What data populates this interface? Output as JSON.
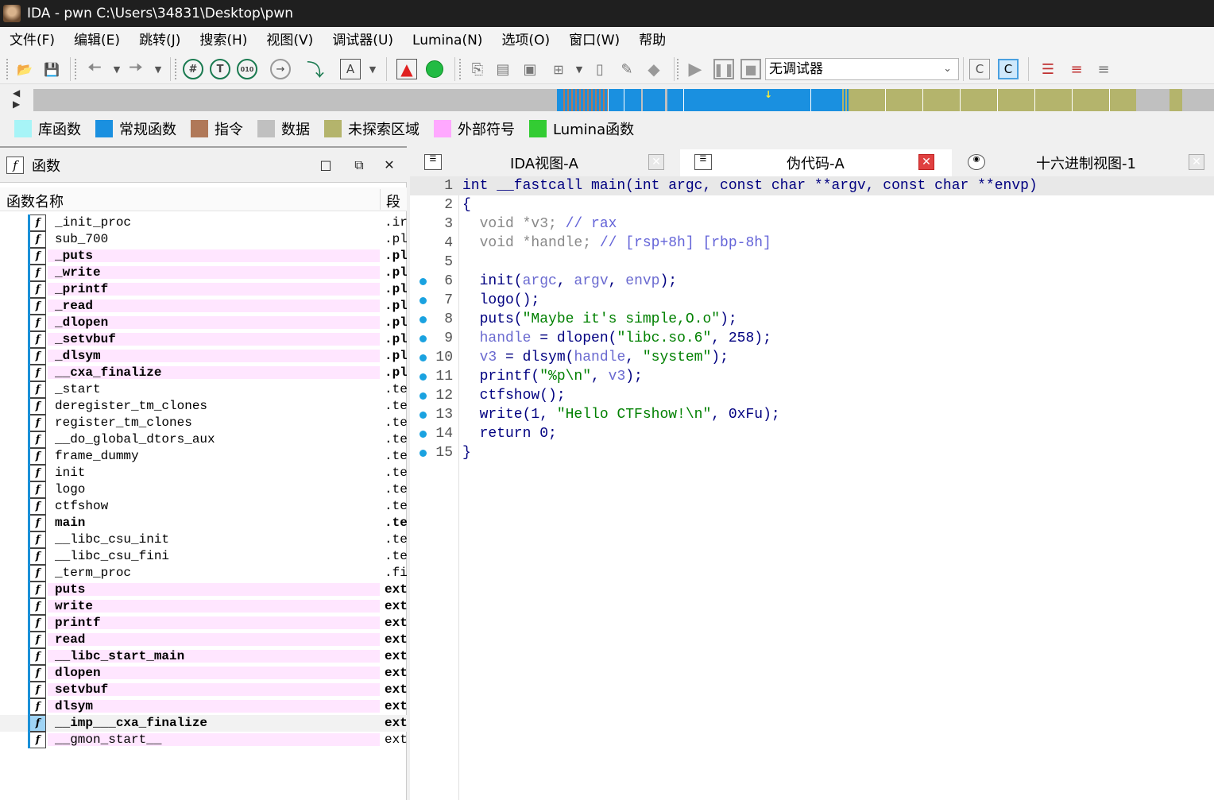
{
  "window": {
    "title": "IDA - pwn C:\\Users\\34831\\Desktop\\pwn"
  },
  "menu": [
    "文件(F)",
    "编辑(E)",
    "跳转(J)",
    "搜索(H)",
    "视图(V)",
    "调试器(U)",
    "Lumina(N)",
    "选项(O)",
    "窗口(W)",
    "帮助"
  ],
  "toolbar": {
    "debugger_select": "无调试器",
    "icons": [
      "open-icon",
      "save-icon",
      "back-icon",
      "forward-icon",
      "hex-icon",
      "text-icon",
      "binary-icon",
      "plugin-icon",
      "jump-icon",
      "string-icon",
      "run-icon",
      "green-circle-icon",
      "play-icon",
      "pause-icon",
      "stop-icon"
    ]
  },
  "legend": [
    {
      "label": "库函数",
      "color": "#a7f4f7"
    },
    {
      "label": "常规函数",
      "color": "#1a90e0"
    },
    {
      "label": "指令",
      "color": "#b07858"
    },
    {
      "label": "数据",
      "color": "#c0c0c0"
    },
    {
      "label": "未探索区域",
      "color": "#b4b46c"
    },
    {
      "label": "外部符号",
      "color": "#ffa8ff"
    },
    {
      "label": "Lumina函数",
      "color": "#33cc33"
    }
  ],
  "functions_panel": {
    "title": "函数",
    "col_name": "函数名称",
    "col_segment": "段",
    "rows": [
      {
        "name": "_init_proc",
        "seg": ".ir",
        "bold": false,
        "pink": false
      },
      {
        "name": "sub_700",
        "seg": ".pl",
        "bold": false,
        "pink": false
      },
      {
        "name": "_puts",
        "seg": ".pl",
        "bold": true,
        "pink": true
      },
      {
        "name": "_write",
        "seg": ".pl",
        "bold": true,
        "pink": true
      },
      {
        "name": "_printf",
        "seg": ".pl",
        "bold": true,
        "pink": true
      },
      {
        "name": "_read",
        "seg": ".pl",
        "bold": true,
        "pink": true
      },
      {
        "name": "_dlopen",
        "seg": ".pl",
        "bold": true,
        "pink": true
      },
      {
        "name": "_setvbuf",
        "seg": ".pl",
        "bold": true,
        "pink": true
      },
      {
        "name": "_dlsym",
        "seg": ".pl",
        "bold": true,
        "pink": true
      },
      {
        "name": "__cxa_finalize",
        "seg": ".pl",
        "bold": true,
        "pink": true
      },
      {
        "name": "_start",
        "seg": ".te",
        "bold": false,
        "pink": false
      },
      {
        "name": "deregister_tm_clones",
        "seg": ".te",
        "bold": false,
        "pink": false
      },
      {
        "name": "register_tm_clones",
        "seg": ".te",
        "bold": false,
        "pink": false
      },
      {
        "name": "__do_global_dtors_aux",
        "seg": ".te",
        "bold": false,
        "pink": false
      },
      {
        "name": "frame_dummy",
        "seg": ".te",
        "bold": false,
        "pink": false
      },
      {
        "name": "init",
        "seg": ".te",
        "bold": false,
        "pink": false
      },
      {
        "name": "logo",
        "seg": ".te",
        "bold": false,
        "pink": false
      },
      {
        "name": "ctfshow",
        "seg": ".te",
        "bold": false,
        "pink": false
      },
      {
        "name": "main",
        "seg": ".te",
        "bold": true,
        "pink": false
      },
      {
        "name": "__libc_csu_init",
        "seg": ".te",
        "bold": false,
        "pink": false
      },
      {
        "name": "__libc_csu_fini",
        "seg": ".te",
        "bold": false,
        "pink": false
      },
      {
        "name": "_term_proc",
        "seg": ".fi",
        "bold": false,
        "pink": false
      },
      {
        "name": "puts",
        "seg": "ext",
        "bold": true,
        "pink": true
      },
      {
        "name": "write",
        "seg": "ext",
        "bold": true,
        "pink": true
      },
      {
        "name": "printf",
        "seg": "ext",
        "bold": true,
        "pink": true
      },
      {
        "name": "read",
        "seg": "ext",
        "bold": true,
        "pink": true
      },
      {
        "name": "__libc_start_main",
        "seg": "ext",
        "bold": true,
        "pink": true
      },
      {
        "name": "dlopen",
        "seg": "ext",
        "bold": true,
        "pink": true
      },
      {
        "name": "setvbuf",
        "seg": "ext",
        "bold": true,
        "pink": true
      },
      {
        "name": "dlsym",
        "seg": "ext",
        "bold": true,
        "pink": true
      },
      {
        "name": "__imp___cxa_finalize",
        "seg": "ext",
        "bold": true,
        "pink": false,
        "selected": true
      },
      {
        "name": "__gmon_start__",
        "seg": "ext",
        "bold": false,
        "pink": true
      }
    ]
  },
  "tabs": [
    {
      "label": "IDA视图-A",
      "active": false
    },
    {
      "label": "伪代码-A",
      "active": true
    },
    {
      "label": "十六进制视图-1",
      "active": false
    }
  ],
  "code": {
    "lines": [
      {
        "n": "1",
        "dot": false
      },
      {
        "n": "2",
        "dot": false
      },
      {
        "n": "3",
        "dot": false
      },
      {
        "n": "4",
        "dot": false
      },
      {
        "n": "5",
        "dot": false
      },
      {
        "n": "6",
        "dot": true
      },
      {
        "n": "7",
        "dot": true
      },
      {
        "n": "8",
        "dot": true
      },
      {
        "n": "9",
        "dot": true
      },
      {
        "n": "10",
        "dot": true
      },
      {
        "n": "11",
        "dot": true
      },
      {
        "n": "12",
        "dot": true
      },
      {
        "n": "13",
        "dot": true
      },
      {
        "n": "14",
        "dot": true
      },
      {
        "n": "15",
        "dot": true
      }
    ],
    "text": {
      "l1_a": "int __fastcall main(int argc, const char **argv, const char **envp)",
      "l2": "{",
      "l3_a": "  void *v3; ",
      "l3_b": "// rax",
      "l4_a": "  void *handle; ",
      "l4_b": "// [rsp+8h] [rbp-8h]",
      "l6_a": "  init(",
      "l6_b": "argc",
      "l6_c": ", ",
      "l6_d": "argv",
      "l6_e": ", ",
      "l6_f": "envp",
      "l6_g": ");",
      "l7": "  logo();",
      "l8_a": "  puts(",
      "l8_b": "\"Maybe it's simple,O.o\"",
      "l8_c": ");",
      "l9_a": "  ",
      "l9_b": "handle",
      "l9_c": " = dlopen(",
      "l9_d": "\"libc.so.6\"",
      "l9_e": ", 258);",
      "l10_a": "  ",
      "l10_b": "v3",
      "l10_c": " = dlsym(",
      "l10_d": "handle",
      "l10_e": ", ",
      "l10_f": "\"system\"",
      "l10_g": ");",
      "l11_a": "  printf(",
      "l11_b": "\"%p\\n\"",
      "l11_c": ", ",
      "l11_d": "v3",
      "l11_e": ");",
      "l12": "  ctfshow();",
      "l13_a": "  write(1, ",
      "l13_b": "\"Hello CTFshow!\\n\"",
      "l13_c": ", 0xFu);",
      "l14": "  return 0;",
      "l15": "}"
    }
  }
}
